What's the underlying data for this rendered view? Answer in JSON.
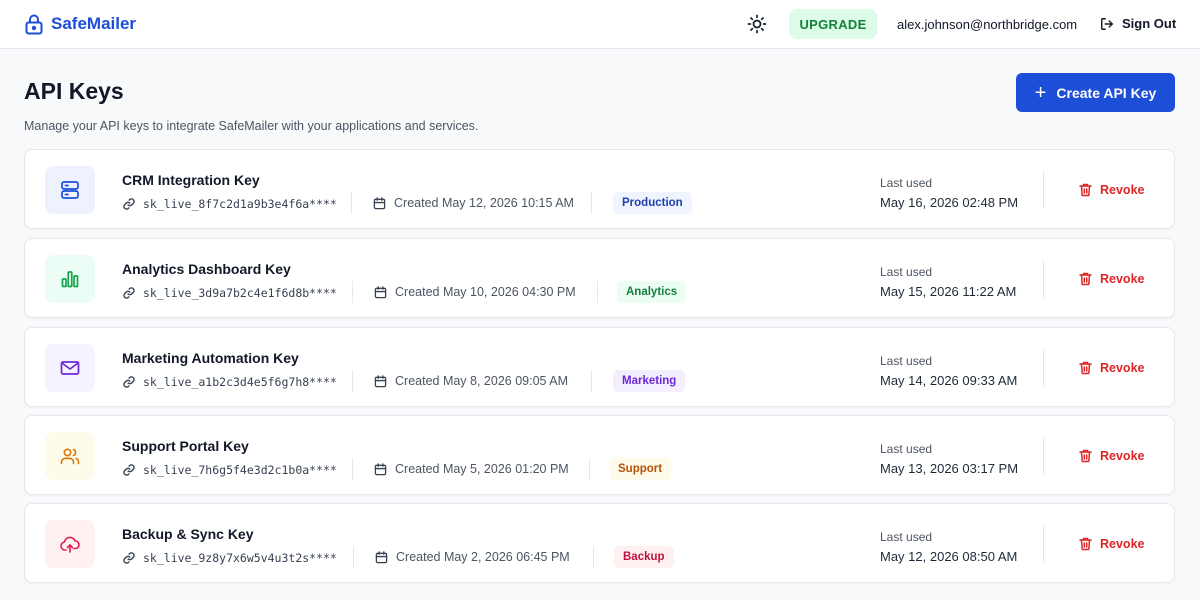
{
  "header": {
    "brand_name": "SafeMailer",
    "upgrade_label": "UPGRADE",
    "user_email": "alex.johnson@northbridge.com",
    "signout_label": "Sign Out"
  },
  "page": {
    "title": "API Keys",
    "subtitle": "Manage your API keys to integrate SafeMailer with your applications and services.",
    "create_label": "Create API Key"
  },
  "colors": {
    "accent": "#1d4ed8",
    "upgrade_bg": "#dcfce7",
    "upgrade_text": "#15803d",
    "revoke": "#dc2626"
  },
  "keys": [
    {
      "name": "CRM Integration Key",
      "key": "sk_live_8f7c2d1a9b3e4f6a****",
      "created": "Created May 12, 2026 10:15 AM",
      "tag": "Production",
      "last_used_label": "Last used",
      "last_used": "May 16, 2026 02:48 PM",
      "revoke_label": "Revoke",
      "icon": "server-icon"
    },
    {
      "name": "Analytics Dashboard Key",
      "key": "sk_live_3d9a7b2c4e1f6d8b****",
      "created": "Created May 10, 2026 04:30 PM",
      "tag": "Analytics",
      "last_used_label": "Last used",
      "last_used": "May 15, 2026 11:22 AM",
      "revoke_label": "Revoke",
      "icon": "bar-chart-icon"
    },
    {
      "name": "Marketing Automation Key",
      "key": "sk_live_a1b2c3d4e5f6g7h8****",
      "created": "Created May 8, 2026 09:05 AM",
      "tag": "Marketing",
      "last_used_label": "Last used",
      "last_used": "May 14, 2026 09:33 AM",
      "revoke_label": "Revoke",
      "icon": "mail-icon"
    },
    {
      "name": "Support Portal Key",
      "key": "sk_live_7h6g5f4e3d2c1b0a****",
      "created": "Created May 5, 2026 01:20 PM",
      "tag": "Support",
      "last_used_label": "Last used",
      "last_used": "May 13, 2026 03:17 PM",
      "revoke_label": "Revoke",
      "icon": "users-icon"
    },
    {
      "name": "Backup & Sync Key",
      "key": "sk_live_9z8y7x6w5v4u3t2s****",
      "created": "Created May 2, 2026 06:45 PM",
      "tag": "Backup",
      "last_used_label": "Last used",
      "last_used": "May 12, 2026 08:50 AM",
      "revoke_label": "Revoke",
      "icon": "cloud-upload-icon"
    }
  ]
}
